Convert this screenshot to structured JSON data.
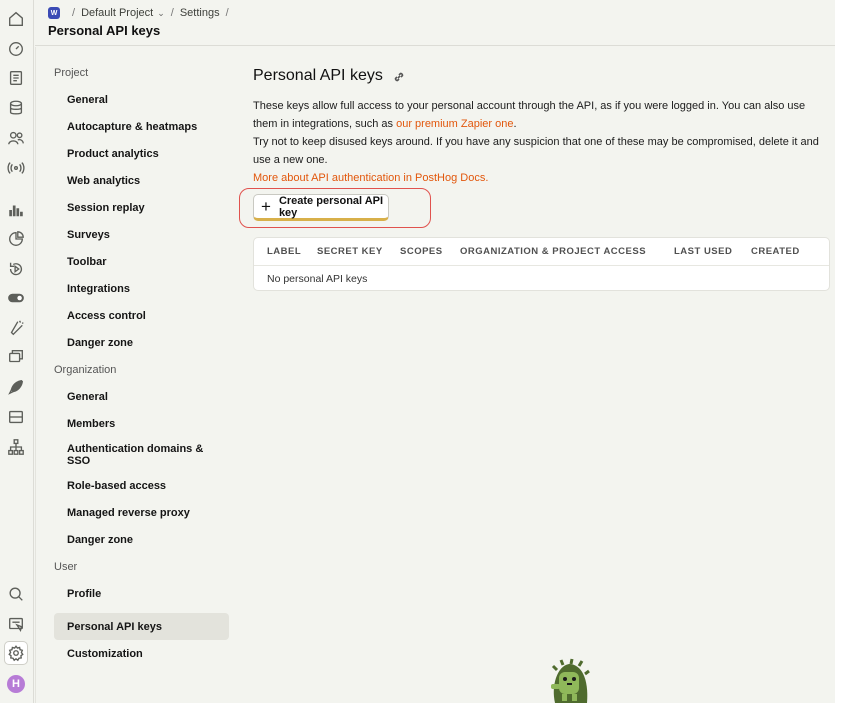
{
  "breadcrumb": {
    "project_badge": "W",
    "project": "Default Project",
    "section": "Settings"
  },
  "page_heading": "Personal API keys",
  "nav": {
    "project_label": "Project",
    "project_items": [
      "General",
      "Autocapture & heatmaps",
      "Product analytics",
      "Web analytics",
      "Session replay",
      "Surveys",
      "Toolbar",
      "Integrations",
      "Access control",
      "Danger zone"
    ],
    "organization_label": "Organization",
    "organization_items": [
      "General",
      "Members",
      "Authentication domains & SSO",
      "Role-based access",
      "Managed reverse proxy",
      "Danger zone"
    ],
    "user_label": "User",
    "user_items": [
      "Profile",
      "Personal API keys",
      "Customization"
    ],
    "active_item": "Personal API keys"
  },
  "content": {
    "title": "Personal API keys",
    "desc_1a": "These keys allow full access to your personal account through the API, as if you were logged in. You can also use them in integrations, such as ",
    "desc_1_link": "our premium Zapier one",
    "desc_1b": ".",
    "desc_2": "Try not to keep disused keys around. If you have any suspicion that one of these may be compromised, delete it and use a new one.",
    "docs_link": "More about API authentication in PostHog Docs.",
    "create_button": "Create personal API key"
  },
  "table": {
    "headers": [
      "LABEL",
      "SECRET KEY",
      "SCOPES",
      "ORGANIZATION & PROJECT ACCESS",
      "LAST USED",
      "CREATED"
    ],
    "empty_text": "No personal API keys"
  },
  "user_avatar": "H",
  "colors": {
    "accent_orange": "#e2570c",
    "highlight_ring": "#e0524e",
    "avatar": "#b77cd6"
  }
}
